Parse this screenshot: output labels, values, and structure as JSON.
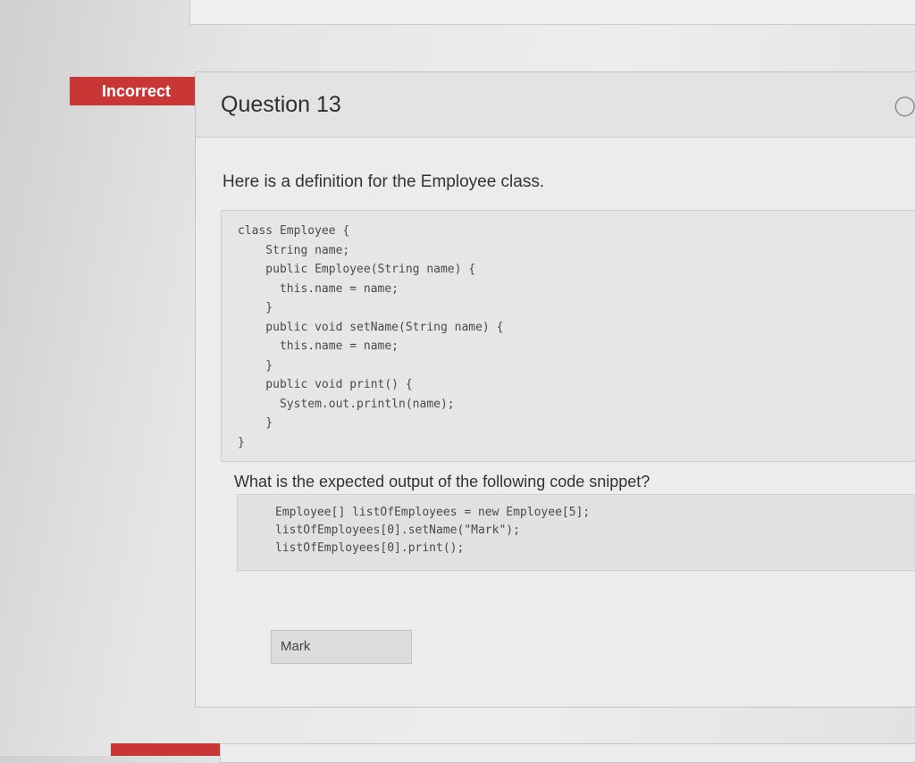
{
  "status": {
    "label": "Incorrect",
    "color": "#c93636"
  },
  "question": {
    "title": "Question 13",
    "prompt": "Here is a definition for the Employee class.",
    "class_code": "class Employee {\n    String name;\n    public Employee(String name) {\n      this.name = name;\n    }\n    public void setName(String name) {\n      this.name = name;\n    }\n    public void print() {\n      System.out.println(name);\n    }\n}",
    "followup": "What is the expected output of the following code snippet?",
    "snippet_code": "Employee[] listOfEmployees = new Employee[5];\nlistOfEmployees[0].setName(\"Mark\");\nlistOfEmployees[0].print();",
    "answer": "Mark"
  }
}
